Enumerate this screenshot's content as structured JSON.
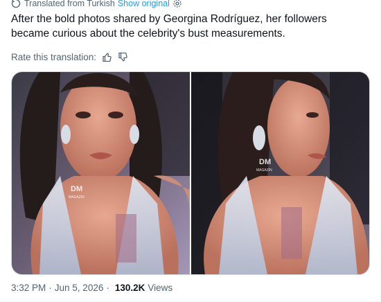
{
  "translation": {
    "notice": "Translated from Turkish",
    "show_original": "Show original"
  },
  "tweet": {
    "text": "After the bold photos shared by Georgina Rodríguez, her followers became curious about the celebrity's bust measurements."
  },
  "rate": {
    "label": "Rate this translation:"
  },
  "media": {
    "watermark_mark": "DM",
    "watermark_text": "MAGAZIN"
  },
  "meta": {
    "time": "3:32 PM",
    "separator": "·",
    "date": "Jun 5, 2026",
    "views_count": "130.2K",
    "views_label": "Views"
  },
  "icons": {
    "translate": "translate-icon",
    "gear": "gear-icon",
    "thumbs_up": "thumbs-up-icon",
    "thumbs_down": "thumbs-down-icon"
  },
  "colors": {
    "link": "#1d9bf0",
    "secondary": "#536471",
    "primary_text": "#0f1419"
  }
}
